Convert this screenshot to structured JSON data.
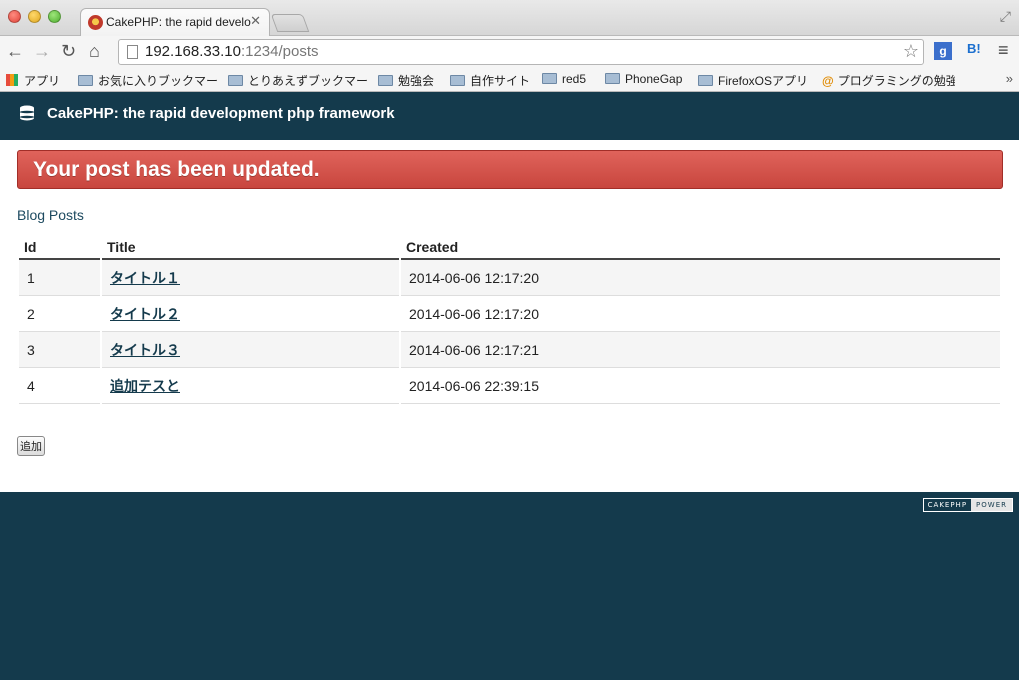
{
  "browser": {
    "tab_title": "CakePHP: the rapid develop",
    "url_host": "192.168.33.10",
    "url_rest": ":1234/posts",
    "bookmarks": [
      "アプリ",
      "お気に入りブックマー",
      "とりあえずブックマー",
      "勉強会",
      "自作サイト",
      "red5",
      "PhoneGap",
      "FirefoxOSアプリ",
      "プログラミングの勉強"
    ]
  },
  "header": {
    "title": "CakePHP: the rapid development php framework"
  },
  "flash": {
    "message": "Your post has been updated."
  },
  "main": {
    "section_title": "Blog Posts",
    "columns": [
      "Id",
      "Title",
      "Created"
    ],
    "rows": [
      {
        "id": "1",
        "title": "タイトル１",
        "created": "2014-06-06 12:17:20"
      },
      {
        "id": "2",
        "title": "タイトル２",
        "created": "2014-06-06 12:17:20"
      },
      {
        "id": "3",
        "title": "タイトル３",
        "created": "2014-06-06 12:17:21"
      },
      {
        "id": "4",
        "title": "追加テスと",
        "created": "2014-06-06 22:39:15"
      }
    ],
    "add_label": "追加"
  },
  "footer": {
    "badge_left": "CAKEPHP",
    "badge_right": "POWER"
  },
  "colors": {
    "brand": "#143a4c",
    "flash": "#c8463e"
  }
}
